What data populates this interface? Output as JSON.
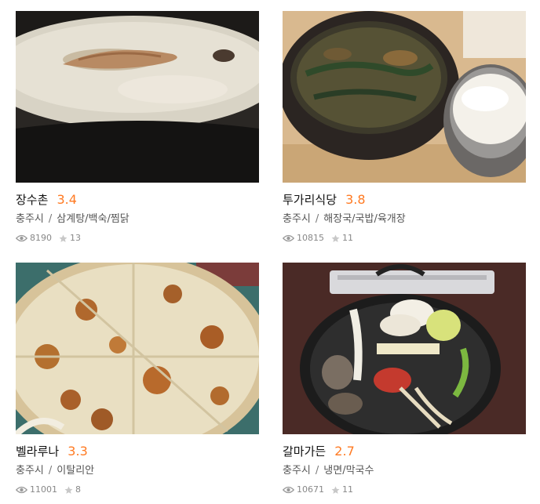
{
  "restaurants": [
    {
      "name": "장수촌",
      "rating": "3.4",
      "city": "충주시",
      "category": "삼계탕/백숙/찜닭",
      "views": "8190",
      "favorites": "13",
      "image_icon": "porridge-photo"
    },
    {
      "name": "투가리식당",
      "rating": "3.8",
      "city": "충주시",
      "category": "해장국/국밥/육개장",
      "views": "10815",
      "favorites": "11",
      "image_icon": "stew-photo"
    },
    {
      "name": "벨라루나",
      "rating": "3.3",
      "city": "충주시",
      "category": "이탈리안",
      "views": "11001",
      "favorites": "8",
      "image_icon": "pizza-photo"
    },
    {
      "name": "갈마가든",
      "rating": "2.7",
      "city": "충주시",
      "category": "냉면/막국수",
      "views": "10671",
      "favorites": "11",
      "image_icon": "hotpot-photo"
    }
  ],
  "separator": "/",
  "colors": {
    "rating": "#ff7a22",
    "meta_text": "#555555",
    "stats_text": "#888888"
  },
  "icons": {
    "views": "eye-icon",
    "favorites": "star-icon"
  }
}
